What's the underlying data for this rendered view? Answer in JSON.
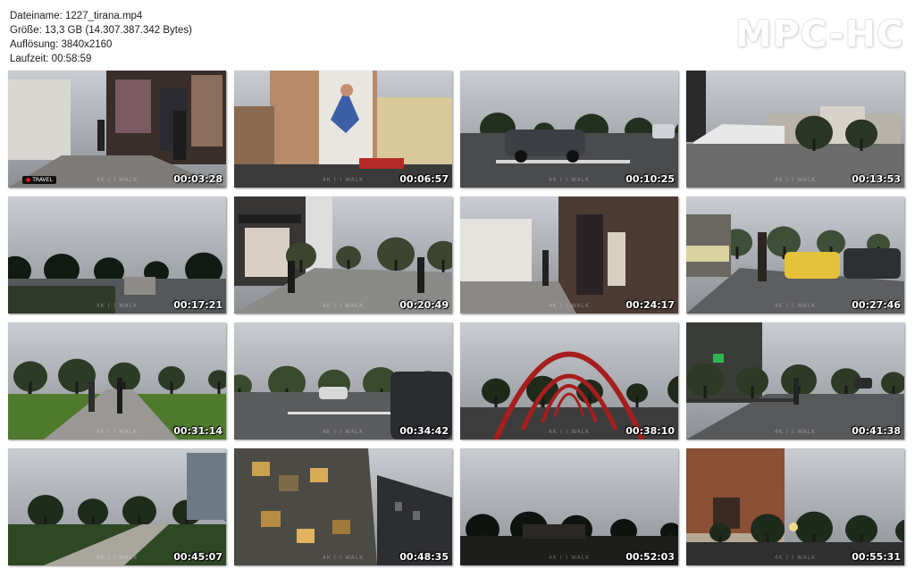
{
  "info": {
    "filename": "Dateiname: 1227_tirana.mp4",
    "size": "Größe: 13,3 GB (14.307.387.342 Bytes)",
    "resolution": "Auflösung: 3840x2160",
    "duration": "Laufzeit: 00:58:59"
  },
  "logo": "MPC-HC",
  "thumbnails": [
    {
      "time": "00:03:28",
      "scene": "street-market"
    },
    {
      "time": "00:06:57",
      "scene": "mural-building"
    },
    {
      "time": "00:10:25",
      "scene": "street-car"
    },
    {
      "time": "00:13:53",
      "scene": "square-tents"
    },
    {
      "time": "00:17:21",
      "scene": "park-dusk"
    },
    {
      "time": "00:20:49",
      "scene": "shop-street"
    },
    {
      "time": "00:24:17",
      "scene": "market-stalls"
    },
    {
      "time": "00:27:46",
      "scene": "street-taxi"
    },
    {
      "time": "00:31:14",
      "scene": "park-path"
    },
    {
      "time": "00:34:42",
      "scene": "boulevard"
    },
    {
      "time": "00:38:10",
      "scene": "red-arches"
    },
    {
      "time": "00:41:38",
      "scene": "pharmacy-street"
    },
    {
      "time": "00:45:07",
      "scene": "park-walkway"
    },
    {
      "time": "00:48:35",
      "scene": "modern-facade"
    },
    {
      "time": "00:52:03",
      "scene": "night-park"
    },
    {
      "time": "00:55:31",
      "scene": "brick-building"
    }
  ],
  "first_badge": "TRAVEL",
  "watermark": "4K  (·)  WALK"
}
